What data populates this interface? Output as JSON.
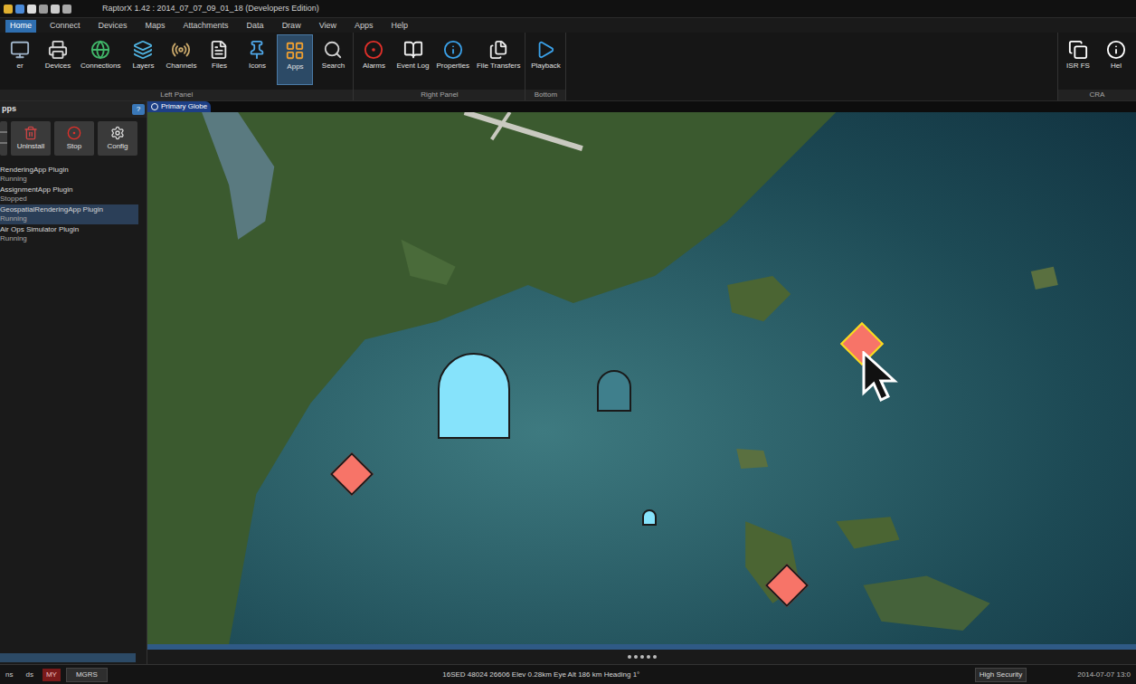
{
  "window": {
    "title": "RaptorX 1.42 : 2014_07_07_09_01_18 (Developers Edition)"
  },
  "menu": [
    {
      "label": "Home",
      "selected": true
    },
    {
      "label": "Connect",
      "selected": false
    },
    {
      "label": "Devices",
      "selected": false
    },
    {
      "label": "Maps",
      "selected": false
    },
    {
      "label": "Attachments",
      "selected": false
    },
    {
      "label": "Data",
      "selected": false
    },
    {
      "label": "Draw",
      "selected": false
    },
    {
      "label": "View",
      "selected": false
    },
    {
      "label": "Apps",
      "selected": false
    },
    {
      "label": "Help",
      "selected": false
    }
  ],
  "ribbon": {
    "groups": [
      {
        "label": "Left Panel",
        "items": [
          {
            "label": "er",
            "selected": false
          },
          {
            "label": "Devices",
            "selected": false
          },
          {
            "label": "Connections",
            "selected": false
          },
          {
            "label": "Layers",
            "selected": false
          },
          {
            "label": "Channels",
            "selected": false
          },
          {
            "label": "Files",
            "selected": false
          },
          {
            "label": "Icons",
            "selected": false
          },
          {
            "label": "Apps",
            "selected": true
          },
          {
            "label": "Search",
            "selected": false
          }
        ]
      },
      {
        "label": "Right Panel",
        "items": [
          {
            "label": "Alarms",
            "selected": false
          },
          {
            "label": "Event Log",
            "selected": false
          },
          {
            "label": "Properties",
            "selected": false
          },
          {
            "label": "File Transfers",
            "selected": false
          }
        ]
      },
      {
        "label": "Bottom",
        "items": [
          {
            "label": "Playback",
            "selected": false
          }
        ]
      }
    ],
    "right_group": {
      "label": "CRA",
      "items": [
        {
          "label": "ISR FS",
          "selected": false
        },
        {
          "label": "Hel",
          "selected": false
        }
      ]
    }
  },
  "left_panel": {
    "title": "pps",
    "help": "?",
    "buttons": [
      {
        "label": ""
      },
      {
        "label": "Uninstall"
      },
      {
        "label": "Stop"
      },
      {
        "label": "Config"
      }
    ],
    "plugins": [
      {
        "name": "RenderingApp Plugin",
        "status": "Running",
        "selected": false
      },
      {
        "name": "AssignmentApp Plugin",
        "status": "Stopped",
        "selected": false
      },
      {
        "name": "GeospatialRenderingApp Plugin",
        "status": "Running",
        "selected": true
      },
      {
        "name": "Air Ops Simulator Plugin",
        "status": "Running",
        "selected": false
      }
    ]
  },
  "map": {
    "tab": "Primary Globe",
    "markers": [
      {
        "kind": "friendly",
        "selected": false,
        "color": "#86e3fb"
      },
      {
        "kind": "friendly",
        "selected": false,
        "color": "#3f7f8c"
      },
      {
        "kind": "friendly",
        "selected": false,
        "color": "#86e3fb"
      },
      {
        "kind": "hostile",
        "selected": false,
        "color": "#f77468"
      },
      {
        "kind": "hostile",
        "selected": true,
        "color": "#f77468"
      },
      {
        "kind": "hostile",
        "selected": false,
        "color": "#f77468"
      }
    ]
  },
  "status_bar": {
    "left": [
      "ns",
      "ds",
      "MY",
      "MGRS"
    ],
    "coords": "16SED 48024 26606 Elev 0.28km Eye Alt 186 km Heading 1°",
    "security": "High Security",
    "time": "2014-07-07 13:0"
  }
}
